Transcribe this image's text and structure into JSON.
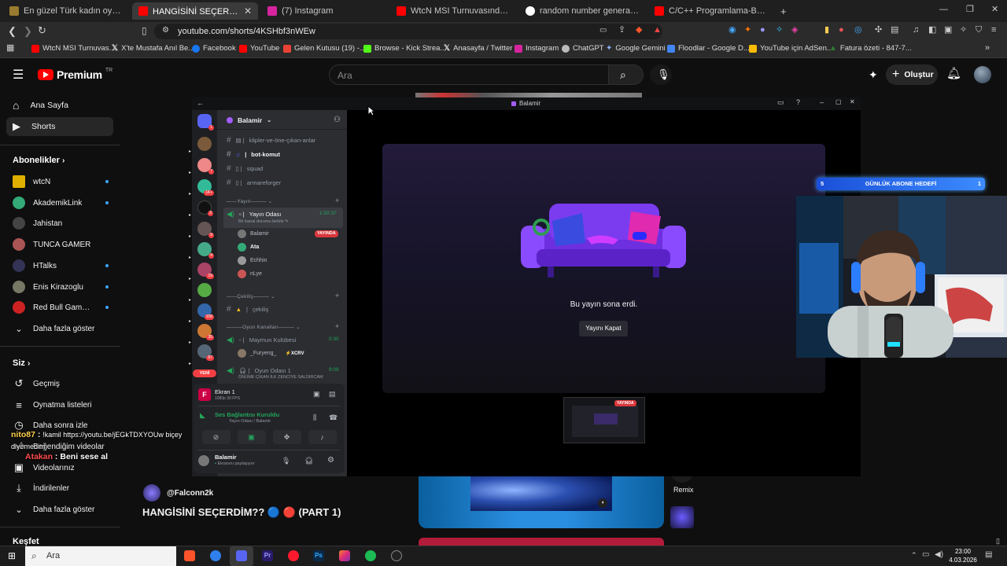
{
  "browser": {
    "tabs": [
      {
        "title": "En güzel Türk kadın oyuncu - Tier Li",
        "color": "#9a7b2f"
      },
      {
        "title": "HANGİSİNİ SEÇERDİM?? 🔵 🔴",
        "color": "#ff0000"
      },
      {
        "title": "(7) Instagram",
        "color": "#d6249f"
      },
      {
        "title": "WtcN MSI Turnuvasında Mithrain i V",
        "color": "#ff0000"
      },
      {
        "title": "random number generator - Google",
        "color": "#ffffff"
      },
      {
        "title": "C/C++ Programlama-Bölüm2-Selam",
        "color": "#ff0000"
      }
    ],
    "new_tab": "+",
    "url": "youtube.com/shorts/4KSHbf3nWEw",
    "bookmarks": [
      {
        "label": "WtcN MSI Turnuvas...",
        "color": "#ff0000"
      },
      {
        "label": "X'te Mustafa Anıl Be...",
        "color": "#ffffff"
      },
      {
        "label": "Facebook",
        "color": "#1877f2"
      },
      {
        "label": "YouTube",
        "color": "#ff0000"
      },
      {
        "label": "Gelen Kutusu (19) -...",
        "color": "#ea4335"
      },
      {
        "label": "Browse - Kick Strea...",
        "color": "#53fc18"
      },
      {
        "label": "Anasayfa / Twitter",
        "color": "#ffffff"
      },
      {
        "label": "Instagram",
        "color": "#d6249f"
      },
      {
        "label": "ChatGPT",
        "color": "#bbbbbb"
      },
      {
        "label": "Google Gemini",
        "color": "#8ab4f8"
      },
      {
        "label": "Floodlar - Google D...",
        "color": "#4285f4"
      },
      {
        "label": "YouTube için AdSen...",
        "color": "#fbbc04"
      },
      {
        "label": "Fatura özeti - 847-7...",
        "color": "#2e7d32"
      }
    ]
  },
  "youtube": {
    "logo": "Premium",
    "logo_sup": "TR",
    "search_placeholder": "Ara",
    "create_label": "Oluştur",
    "nav": [
      {
        "label": "Ana Sayfa",
        "icon": "home-icon"
      },
      {
        "label": "Shorts",
        "icon": "shorts-icon"
      }
    ],
    "subscriptions_title": "Abonelikler",
    "subscriptions": [
      {
        "name": "wtcN",
        "color": "#e0b000"
      },
      {
        "name": "AkademikLink",
        "color": "#3a7"
      },
      {
        "name": "Jahistan",
        "color": "#444"
      },
      {
        "name": "TUNCA GAMER",
        "color": "#a55"
      },
      {
        "name": "HTalks",
        "color": "#335"
      },
      {
        "name": "Enis Kirazoglu",
        "color": "#776"
      },
      {
        "name": "Red Bull Gamers...",
        "color": "#c22"
      }
    ],
    "show_more": "Daha fazla göster",
    "you_title": "Siz",
    "you_items": [
      "Geçmiş",
      "Oynatma listeleri",
      "Daha sonra izle",
      "Beğendiğim videolar",
      "Videolarınız",
      "İndirilenler"
    ],
    "show_more_2": "Daha fazla göster",
    "explore_title": "Keşfet",
    "channel": "@Falconn2k",
    "video_title": "HANGİSİNİ SEÇERDİM?? 🔵 🔴 (PART 1)",
    "remix_label": "Remix"
  },
  "discord": {
    "window_title": "Balamir",
    "server_name": "Balamir",
    "channels": [
      {
        "name": "klipler-ve-öne-çıkan-anlar",
        "bold": false
      },
      {
        "name": "bot-komut",
        "bold": true
      },
      {
        "name": "squad",
        "bold": false
      },
      {
        "name": "armareforger",
        "bold": false
      }
    ],
    "category_yayin": "Yayın",
    "voice_channel": "Yayın Odası",
    "voice_timer": "1:50:37",
    "voice_status": "Bir kanal durumu belirle",
    "voice_users": [
      {
        "name": "Balamir",
        "live": "YAYINDA",
        "color": "#777"
      },
      {
        "name": "Ata",
        "live": "",
        "color": "#3a7"
      },
      {
        "name": "Echhin",
        "live": "",
        "color": "#999"
      },
      {
        "name": "nLye",
        "live": "",
        "color": "#c55"
      }
    ],
    "category_cekilis": "Çekiliş",
    "cekilis_channel": "çekiliş",
    "category_oyun": "Oyun Kanalları",
    "oyun_channel_1": "Maymun Kulübesi",
    "oyun_timer_1": "0:30",
    "oyun_user_1": "_Furyeng_",
    "oyun_tag_1": "XCRV",
    "oyun_channel_2": "Oyun Odası 1",
    "oyun_timer_2": "9:09",
    "oyun_status_2": "ÖNÜME ÇIKAN İLK ZENCİYE SALDIRCAM",
    "new_badge": "YENİ",
    "screen_title": "Ekran 1",
    "screen_sub": "1080p 30 FPS",
    "voice_connected": "Ses Bağlantısı Kuruldu",
    "voice_connected_sub": "Yayın Odası / Balamir",
    "user_name": "Balamir",
    "user_status": "Ekranını paylaşıyor",
    "stream_ended": "Bu yayın sona erdi.",
    "close_stream": "Yayını Kapat",
    "preview_live": "YAYINDA"
  },
  "overlay": {
    "goal_left": "5",
    "goal_label": "GÜNLÜK ABONE HEDEFİ",
    "goal_right": "1"
  },
  "chat": [
    {
      "user": "nito87",
      "text": "!kamil https://youtu.be/jEGkTDXYOUw biçey diyemedim",
      "color": "#ffd24d"
    },
    {
      "user": "Atakan",
      "text": "Beni sese al",
      "color": "#ff4d4d"
    }
  ],
  "taskbar": {
    "search": "Ara",
    "time": "23:00",
    "date": "4.03.2026"
  }
}
